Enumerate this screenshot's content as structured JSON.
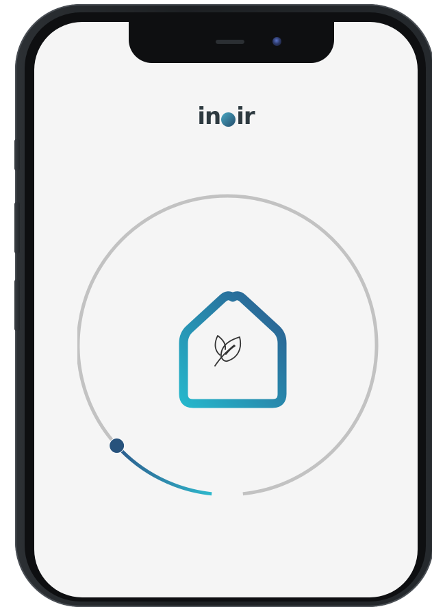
{
  "app": {
    "logo_text_start": "in",
    "logo_text_end": "ir"
  },
  "icons": {
    "house": "house-icon",
    "leaf": "leaf-icon"
  },
  "dial": {
    "progress": 0.12
  },
  "colors": {
    "accent_start": "#26b7cc",
    "accent_end": "#2b5a8d",
    "track": "#c2c2c2",
    "screen_bg": "#f5f5f5"
  }
}
